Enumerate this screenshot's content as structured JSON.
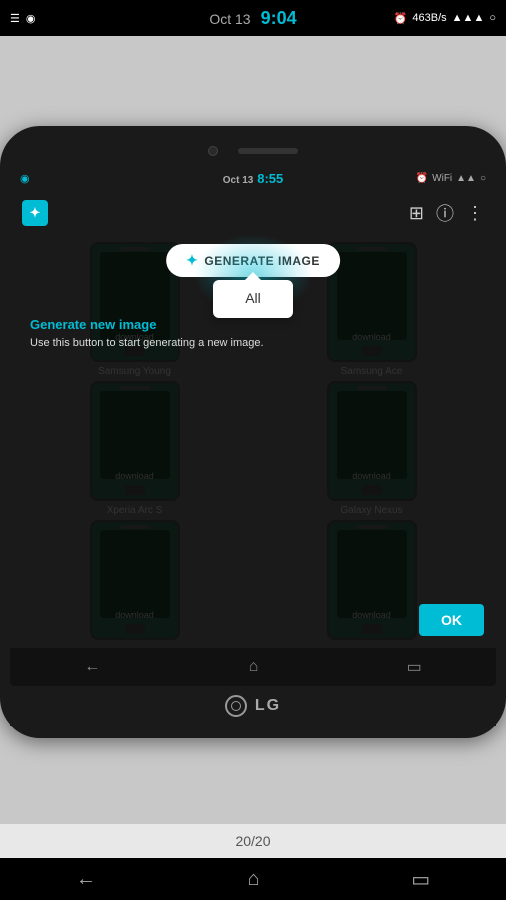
{
  "system_bar": {
    "time": "9:04",
    "date": "Oct 13",
    "speed": "463B/s",
    "battery_icon": "○"
  },
  "phone_status": {
    "time": "8:55",
    "date": "Oct 13"
  },
  "app": {
    "generate_button_label": "GENERATE IMAGE",
    "tooltip_text": "All",
    "info_title": "Generate new image",
    "info_desc": "Use this button to start generating a new image.",
    "ok_button": "OK"
  },
  "devices": [
    {
      "name": "Samsung Young",
      "download": "download"
    },
    {
      "name": "Samsung Ace",
      "download": "download"
    },
    {
      "name": "Xperia Arc S",
      "download": "download"
    },
    {
      "name": "Galaxy Nexus",
      "download": "download"
    },
    {
      "name": "",
      "download": "download"
    },
    {
      "name": "",
      "download": "download"
    }
  ],
  "lg_brand": "LG",
  "page_count": "20/20",
  "nav": {
    "back": "←",
    "home": "⌂",
    "recents": "▭"
  }
}
